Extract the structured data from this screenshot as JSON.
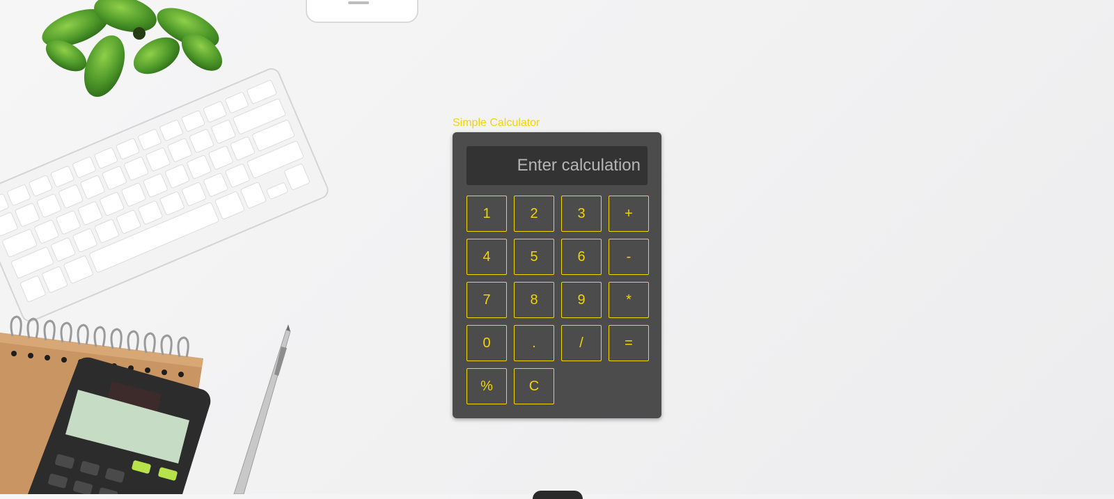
{
  "calculator": {
    "title": "Simple Calculator",
    "display": {
      "value": "",
      "placeholder": "Enter calculation"
    },
    "keys": [
      {
        "label": "1",
        "name": "key-1-button"
      },
      {
        "label": "2",
        "name": "key-2-button"
      },
      {
        "label": "3",
        "name": "key-3-button"
      },
      {
        "label": "+",
        "name": "key-add-button"
      },
      {
        "label": "4",
        "name": "key-4-button"
      },
      {
        "label": "5",
        "name": "key-5-button"
      },
      {
        "label": "6",
        "name": "key-6-button"
      },
      {
        "label": "-",
        "name": "key-subtract-button"
      },
      {
        "label": "7",
        "name": "key-7-button"
      },
      {
        "label": "8",
        "name": "key-8-button"
      },
      {
        "label": "9",
        "name": "key-9-button"
      },
      {
        "label": "*",
        "name": "key-multiply-button"
      },
      {
        "label": "0",
        "name": "key-0-button"
      },
      {
        "label": ".",
        "name": "key-decimal-button"
      },
      {
        "label": "/",
        "name": "key-divide-button"
      },
      {
        "label": "=",
        "name": "key-equals-button"
      },
      {
        "label": "%",
        "name": "key-percent-button"
      },
      {
        "label": "C",
        "name": "key-clear-button"
      }
    ]
  },
  "theme": {
    "accent": "#f2d400",
    "panel": "#4c4c4c",
    "display": "#333333"
  },
  "background": {
    "objects": [
      "plant",
      "keyboard",
      "phone",
      "notebook",
      "calculator-device",
      "pen"
    ]
  }
}
